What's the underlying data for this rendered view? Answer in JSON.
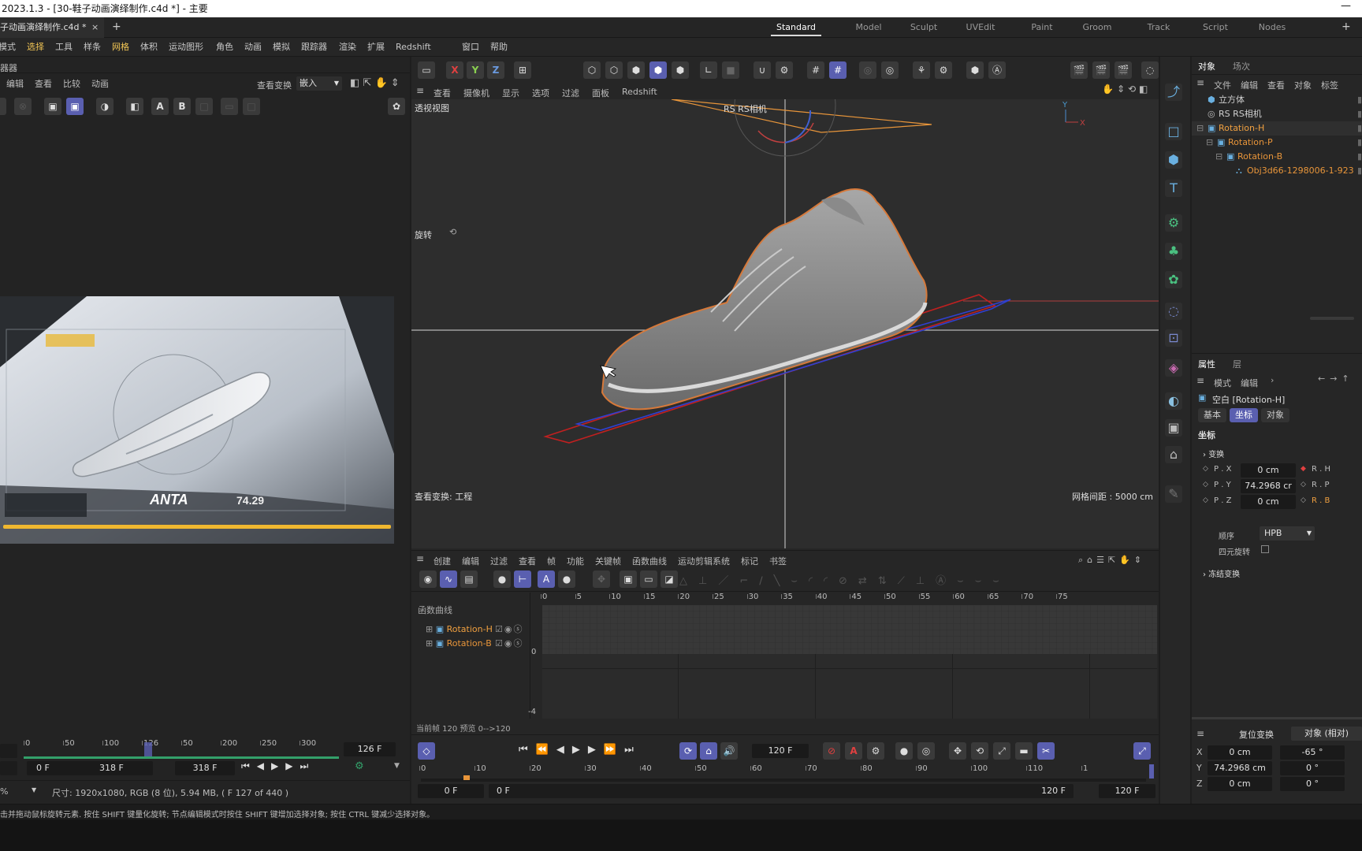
{
  "window": {
    "title": "2023.1.3 - [30-鞋子动画演绎制作.c4d *] - 主要",
    "minimize": "—"
  },
  "document_tab": {
    "label": "子动画演绎制作.c4d *",
    "close": "×",
    "add": "+"
  },
  "layouts": {
    "items": [
      "Standard",
      "Model",
      "Sculpt",
      "UVEdit",
      "Paint",
      "Groom",
      "Track",
      "Script",
      "Nodes"
    ],
    "active": "Standard",
    "add": "+"
  },
  "menu": {
    "items": [
      "模式",
      "选择",
      "工具",
      "样条",
      "网格",
      "体积",
      "运动图形",
      "角色",
      "动画",
      "模拟",
      "跟踪器",
      "渲染",
      "扩展",
      "Redshift",
      "窗口",
      "帮助"
    ]
  },
  "left_panel": {
    "title": "器器",
    "menu": [
      "编辑",
      "查看",
      "比较",
      "动画"
    ],
    "view_transform_label": "查看变换",
    "view_transform_value": "嵌入",
    "image_text": {
      "brand": "ANTA",
      "number": "74.29"
    },
    "mini_ruler": [
      "0",
      "50",
      "100",
      "126",
      "50",
      "200",
      "250",
      "300"
    ],
    "current_frame": "126 F",
    "range_start": "0 F",
    "range_end": "318 F",
    "range_end2": "318 F",
    "zoom": "%",
    "info": "尺寸: 1920x1080, RGB (8 位), 5.94 MB, ( F 127 of 440 )"
  },
  "viewport": {
    "axis_buttons": [
      "X",
      "Y",
      "Z"
    ],
    "menu": [
      "查看",
      "摄像机",
      "显示",
      "选项",
      "过滤",
      "面板",
      "Redshift"
    ],
    "label": "透视视图",
    "camera_label": "RS RS相机",
    "rotate_label": "旋转",
    "view_transform": "查看变换: 工程",
    "grid_spacing": "网格间距 : 5000 cm",
    "axis_y": "Y",
    "axis_x": "X"
  },
  "timeline_editor": {
    "menu": [
      "创建",
      "编辑",
      "过滤",
      "查看",
      "帧",
      "功能",
      "关键帧",
      "函数曲线",
      "运动剪辑系统",
      "标记",
      "书签"
    ],
    "title": "函数曲线",
    "ruler": [
      "0",
      "5",
      "10",
      "15",
      "20",
      "25",
      "30",
      "35",
      "40",
      "45",
      "50",
      "55",
      "60",
      "65",
      "70",
      "75"
    ],
    "y_labels": [
      "0",
      "-4"
    ],
    "tracks": [
      {
        "name": "Rotation-H"
      },
      {
        "name": "Rotation-B"
      }
    ],
    "status": "当前帧  120  预览  0-->120"
  },
  "transport": {
    "frame_field": "120 F",
    "ruler": [
      "0",
      "10",
      "20",
      "30",
      "40",
      "50",
      "60",
      "70",
      "80",
      "90",
      "100",
      "110",
      "1"
    ],
    "start": "0 F",
    "start2": "0 F",
    "end": "120 F",
    "end2": "120 F"
  },
  "status_bar": {
    "hint": "击并拖动鼠标旋转元素. 按住 SHIFT 键量化旋转; 节点编辑模式时按住 SHIFT 键增加选择对象; 按住 CTRL 键减少选择对象。"
  },
  "object_manager": {
    "tabs": [
      "对象",
      "场次"
    ],
    "menu": [
      "文件",
      "编辑",
      "查看",
      "对象",
      "标签"
    ],
    "objects": [
      {
        "name": "立方体",
        "indent": 0,
        "color": "#d0d0d0"
      },
      {
        "name": "RS RS相机",
        "indent": 0,
        "color": "#d0d0d0"
      },
      {
        "name": "Rotation-H",
        "indent": 0,
        "color": "#f0a040"
      },
      {
        "name": "Rotation-P",
        "indent": 1,
        "color": "#e8953a"
      },
      {
        "name": "Rotation-B",
        "indent": 2,
        "color": "#e8953a"
      },
      {
        "name": "Obj3d66-1298006-1-923",
        "indent": 3,
        "color": "#e8953a"
      }
    ]
  },
  "attributes": {
    "tabs": [
      "属性",
      "层"
    ],
    "menu": [
      "模式",
      "编辑"
    ],
    "object_title": "空白 [Rotation-H]",
    "sub_tabs": [
      "基本",
      "坐标",
      "对象"
    ],
    "active_sub_tab": "坐标",
    "section": "坐标",
    "group": "变换",
    "rows": [
      {
        "label": "P . X",
        "value": "0 cm",
        "rlabel": "R . H"
      },
      {
        "label": "P . Y",
        "value": "74.2968 cr",
        "rlabel": "R . P"
      },
      {
        "label": "P . Z",
        "value": "0 cm",
        "rlabel": "R . B"
      }
    ],
    "order_label": "顺序",
    "order_value": "HPB",
    "quat_label": "四元旋转",
    "freeze_label": "冻结变换"
  },
  "coordinates": {
    "reset_button": "复位变换",
    "mode_button": "对象 (相对)",
    "rows": [
      {
        "axis": "X",
        "pos": "0 cm",
        "rot": "-65 °"
      },
      {
        "axis": "Y",
        "pos": "74.2968 cm",
        "rot": "0 °"
      },
      {
        "axis": "Z",
        "pos": "0 cm",
        "rot": "0 °"
      }
    ]
  },
  "colors": {
    "accent": "#5a5fb0",
    "highlight": "#f0c454",
    "orange": "#e8953a"
  }
}
